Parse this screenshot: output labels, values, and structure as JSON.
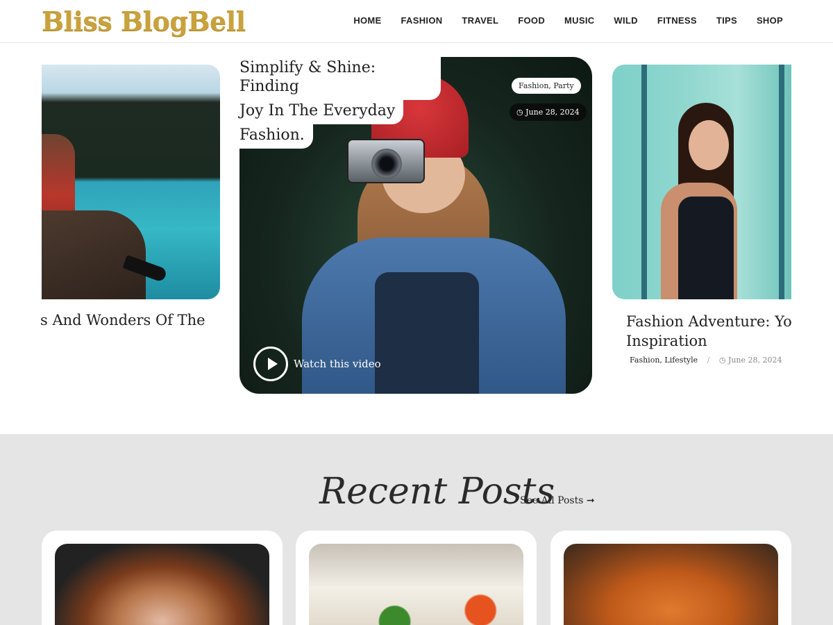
{
  "header": {
    "logo": "Bliss BlogBell",
    "nav": [
      "HOME",
      "FASHION",
      "TRAVEL",
      "FOOD",
      "MUSIC",
      "WILD",
      "FITNESS",
      "TIPS",
      "SHOP"
    ]
  },
  "slider": {
    "left": {
      "title": "s And Wonders Of The"
    },
    "main": {
      "title_lines": [
        "Simplify & Shine: Finding",
        "Joy In The Everyday",
        "Fashion."
      ],
      "tags": "Fashion, Party",
      "date": "June 28, 2024",
      "watch_label": "Watch this video"
    },
    "right": {
      "title_line1": "Fashion Adventure: You",
      "title_line2": "Inspiration",
      "tags": "Fashion, Lifestyle",
      "separator": "/",
      "date": "June 28, 2024"
    }
  },
  "recent": {
    "title": "Recent Posts",
    "see_all": "See All Posts ➞"
  },
  "colors": {
    "logo_gold": "#c9a23c",
    "section_bg": "#e5e5e5"
  }
}
